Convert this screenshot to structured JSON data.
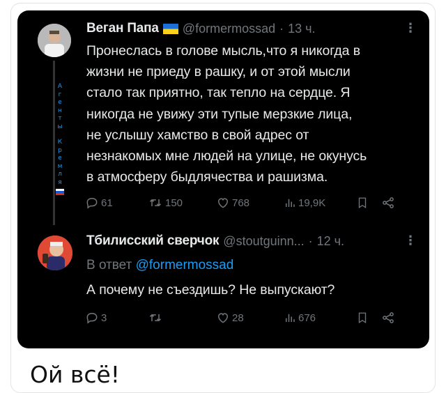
{
  "tweet": {
    "author_name": "Веган Папа",
    "handle": "@formermossad",
    "dot": "·",
    "time": "13 ч.",
    "more": "⋮",
    "lines": [
      "Пронеслась в голове мысль,что я никогда в",
      "жизни не приеду в рашку, и от этой мысли",
      "стало так приятно, так тепло на сердце. Я",
      "никогда не увижу эти тупые мерзкие лица,",
      "не услышу хамство в свой адрес от",
      "незнакомых мне людей на улице, не окунусь",
      "в атмосферу быдлячества и рашизма."
    ],
    "agent_label": [
      "А",
      "г",
      "е",
      "н",
      "т",
      "ы",
      "",
      "К",
      "р",
      "е",
      "м",
      "л",
      "я"
    ],
    "replies": "61",
    "reposts": "150",
    "likes": "768",
    "views": "19,9K"
  },
  "reply": {
    "author_name": "Тбилисский сверчок",
    "handle": "@stoutguinn...",
    "dot": "·",
    "time": "12 ч.",
    "more": "⋮",
    "reply_prefix": "В ответ",
    "reply_handle": "@formermossad",
    "text": "А почему не съездишь? Не выпускают?",
    "replies": "3",
    "reposts": "",
    "likes": "28",
    "views": "676"
  },
  "caption": "Ой всё!",
  "colors": {
    "card_bg": "#000000",
    "text": "#e7e9ea",
    "muted": "#71767b",
    "link": "#1d9bf0"
  }
}
